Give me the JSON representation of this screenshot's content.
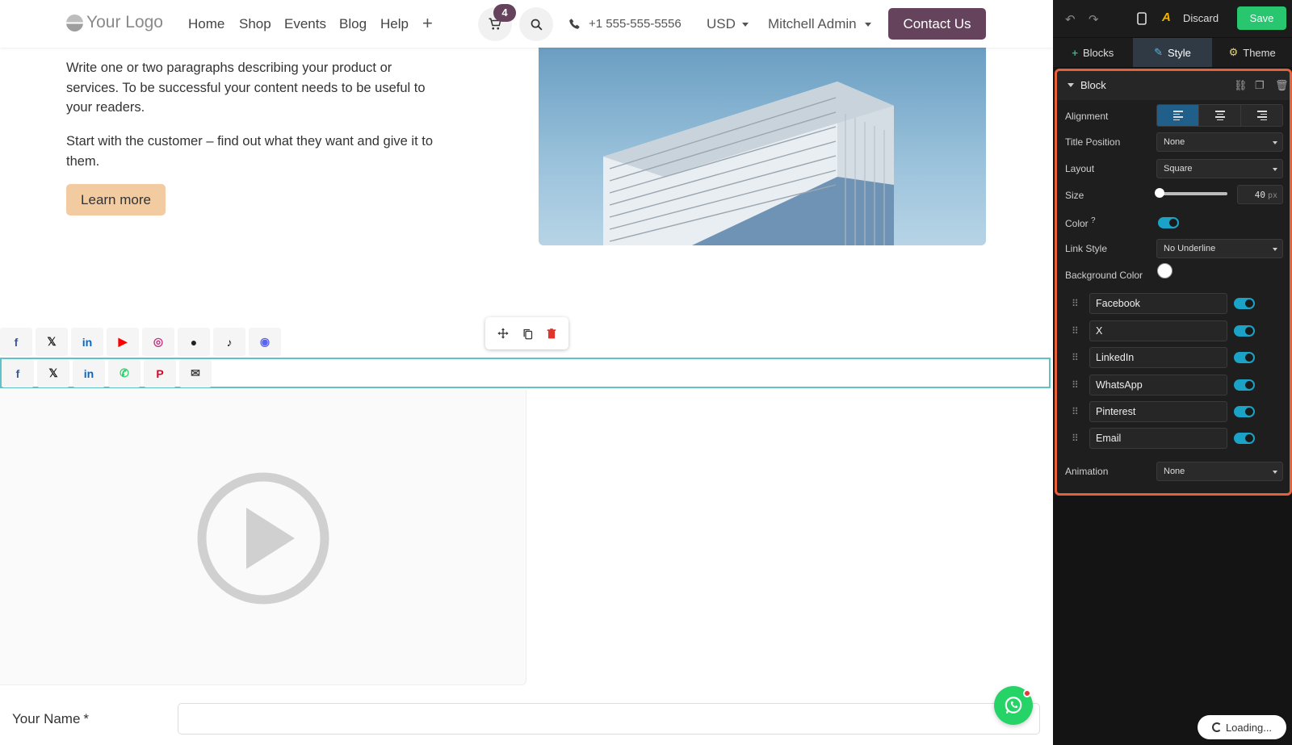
{
  "navbar": {
    "logo_text": "Your Logo",
    "links": [
      "Home",
      "Shop",
      "Events",
      "Blog",
      "Help"
    ],
    "plus": "+",
    "cart_count": "4",
    "phone": "+1 555-555-5556",
    "currency": "USD",
    "user": "Mitchell Admin",
    "contact_label": "Contact Us"
  },
  "content": {
    "paragraph_1": "Write one or two paragraphs describing your product or services. To be successful your content needs to be useful to your readers.",
    "paragraph_2": "Start with the customer – find out what they want and give it to them.",
    "learn_more": "Learn more"
  },
  "social_row_1": [
    {
      "icon": "facebook-icon",
      "glyph": "f",
      "color": "#3b5998"
    },
    {
      "icon": "x-icon",
      "glyph": "𝕏",
      "color": "#222222"
    },
    {
      "icon": "linkedin-icon",
      "glyph": "in",
      "color": "#0a66c2"
    },
    {
      "icon": "youtube-icon",
      "glyph": "▶",
      "color": "#ff0000"
    },
    {
      "icon": "instagram-icon",
      "glyph": "◎",
      "color": "#c13584"
    },
    {
      "icon": "github-icon",
      "glyph": "●",
      "color": "#222222"
    },
    {
      "icon": "tiktok-icon",
      "glyph": "♪",
      "color": "#111111"
    },
    {
      "icon": "discord-icon",
      "glyph": "◉",
      "color": "#5865f2"
    }
  ],
  "social_row_2": [
    {
      "icon": "facebook-icon",
      "glyph": "f",
      "color": "#3b5998"
    },
    {
      "icon": "x-icon",
      "glyph": "𝕏",
      "color": "#222222"
    },
    {
      "icon": "linkedin-icon",
      "glyph": "in",
      "color": "#0a66c2"
    },
    {
      "icon": "whatsapp-icon",
      "glyph": "✆",
      "color": "#25d366"
    },
    {
      "icon": "pinterest-icon",
      "glyph": "P",
      "color": "#e60023"
    },
    {
      "icon": "email-icon",
      "glyph": "✉",
      "color": "#444444"
    }
  ],
  "form": {
    "name_label": "Your Name",
    "required_mark": "*"
  },
  "editor": {
    "discard": "Discard",
    "save": "Save",
    "tabs": [
      "Blocks",
      "Style",
      "Theme"
    ],
    "active_tab": "Style",
    "block_title": "Block",
    "options": {
      "alignment_label": "Alignment",
      "alignment_value": "left",
      "title_position_label": "Title Position",
      "title_position_value": "None",
      "layout_label": "Layout",
      "layout_value": "Square",
      "size_label": "Size",
      "size_value": "40",
      "size_unit": "px",
      "color_label": "Color",
      "color_help": "?",
      "link_style_label": "Link Style",
      "link_style_value": "No Underline",
      "background_color_label": "Background Color",
      "animation_label": "Animation",
      "animation_value": "None"
    },
    "networks": [
      {
        "name": "Facebook",
        "enabled": true
      },
      {
        "name": "X",
        "enabled": true
      },
      {
        "name": "LinkedIn",
        "enabled": true
      },
      {
        "name": "WhatsApp",
        "enabled": true
      },
      {
        "name": "Pinterest",
        "enabled": true
      },
      {
        "name": "Email",
        "enabled": true
      }
    ]
  },
  "loading_text": "Loading...",
  "colors": {
    "brand": "#65435c",
    "learn_more_bg": "#f2cba1",
    "save_green": "#28c76f",
    "selection_outline": "#5fc2c6",
    "panel_highlight": "#e3623a",
    "toggle_on": "#1aa3c6"
  }
}
